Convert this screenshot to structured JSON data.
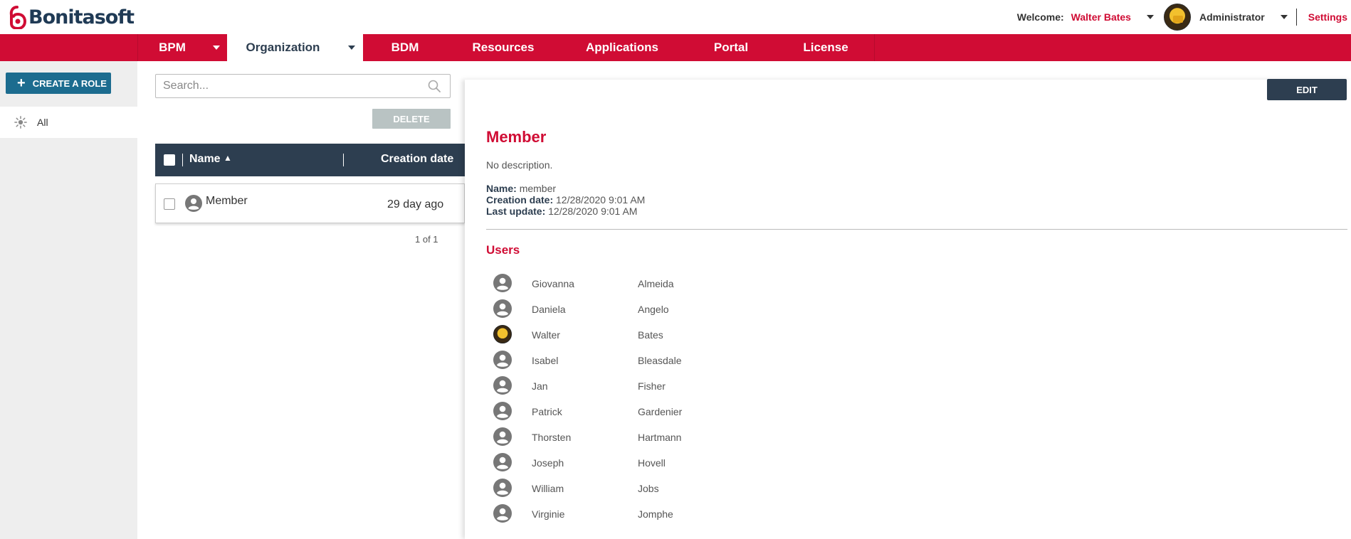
{
  "header": {
    "logo_text": "Bonitasoft",
    "welcome_label": "Welcome:",
    "user_name": "Walter Bates",
    "role": "Administrator",
    "settings_label": "Settings"
  },
  "nav": {
    "items": [
      {
        "label": "BPM",
        "has_caret": true,
        "active": false
      },
      {
        "label": "Organization",
        "has_caret": true,
        "active": true
      },
      {
        "label": "BDM",
        "has_caret": false,
        "active": false
      },
      {
        "label": "Resources",
        "has_caret": false,
        "active": false
      },
      {
        "label": "Applications",
        "has_caret": false,
        "active": false
      },
      {
        "label": "Portal",
        "has_caret": false,
        "active": false
      },
      {
        "label": "License",
        "has_caret": false,
        "active": false
      }
    ]
  },
  "sidebar": {
    "create_label": "CREATE A ROLE",
    "filter_all": "All"
  },
  "list": {
    "search_placeholder": "Search...",
    "delete_label": "DELETE",
    "columns": {
      "name": "Name",
      "creation_date": "Creation date"
    },
    "rows": [
      {
        "name": "Member",
        "creation_date": "29 day ago"
      }
    ],
    "pager": "1 of 1"
  },
  "detail": {
    "edit_label": "EDIT",
    "title": "Member",
    "description": "No description.",
    "name_label": "Name:",
    "name_value": "member",
    "creation_label": "Creation date:",
    "creation_value": "12/28/2020 9:01 AM",
    "update_label": "Last update:",
    "update_value": "12/28/2020 9:01 AM",
    "users_title": "Users",
    "users": [
      {
        "first": "Giovanna",
        "last": "Almeida",
        "avatar": "default"
      },
      {
        "first": "Daniela",
        "last": "Angelo",
        "avatar": "default"
      },
      {
        "first": "Walter",
        "last": "Bates",
        "avatar": "photo"
      },
      {
        "first": "Isabel",
        "last": "Bleasdale",
        "avatar": "default"
      },
      {
        "first": "Jan",
        "last": "Fisher",
        "avatar": "default"
      },
      {
        "first": "Patrick",
        "last": "Gardenier",
        "avatar": "default"
      },
      {
        "first": "Thorsten",
        "last": "Hartmann",
        "avatar": "default"
      },
      {
        "first": "Joseph",
        "last": "Hovell",
        "avatar": "default"
      },
      {
        "first": "William",
        "last": "Jobs",
        "avatar": "default"
      },
      {
        "first": "Virginie",
        "last": "Jomphe",
        "avatar": "default"
      }
    ]
  },
  "colors": {
    "brand_red": "#d00c34",
    "navy": "#2d3e50",
    "teal_button": "#1c6c8f"
  }
}
